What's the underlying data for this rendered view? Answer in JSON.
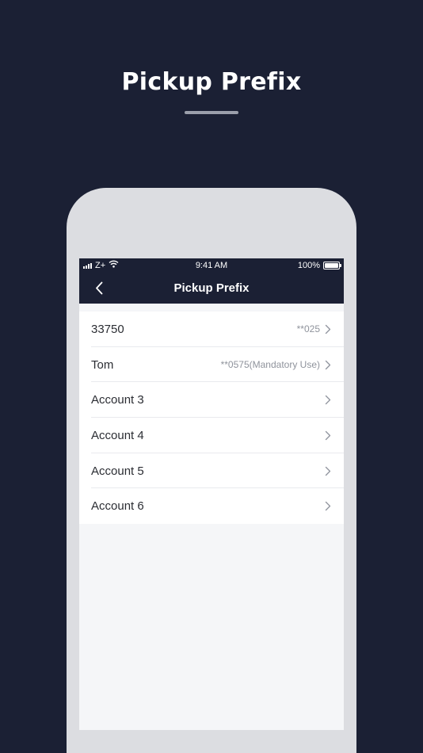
{
  "promo": {
    "title": "Pickup Prefix"
  },
  "status_bar": {
    "carrier": "Z+",
    "time": "9:41 AM",
    "battery": "100%"
  },
  "nav": {
    "title": "Pickup Prefix",
    "back_icon": "chevron-left-icon"
  },
  "accounts": [
    {
      "label": "33750",
      "value": "**025"
    },
    {
      "label": "Tom",
      "value": "**0575(Mandatory Use)"
    },
    {
      "label": "Account 3",
      "value": ""
    },
    {
      "label": "Account 4",
      "value": ""
    },
    {
      "label": "Account 5",
      "value": ""
    },
    {
      "label": "Account 6",
      "value": ""
    }
  ],
  "colors": {
    "background": "#1b2034",
    "phone_frame": "#dcdde1",
    "screen_bg": "#f5f6f8"
  }
}
